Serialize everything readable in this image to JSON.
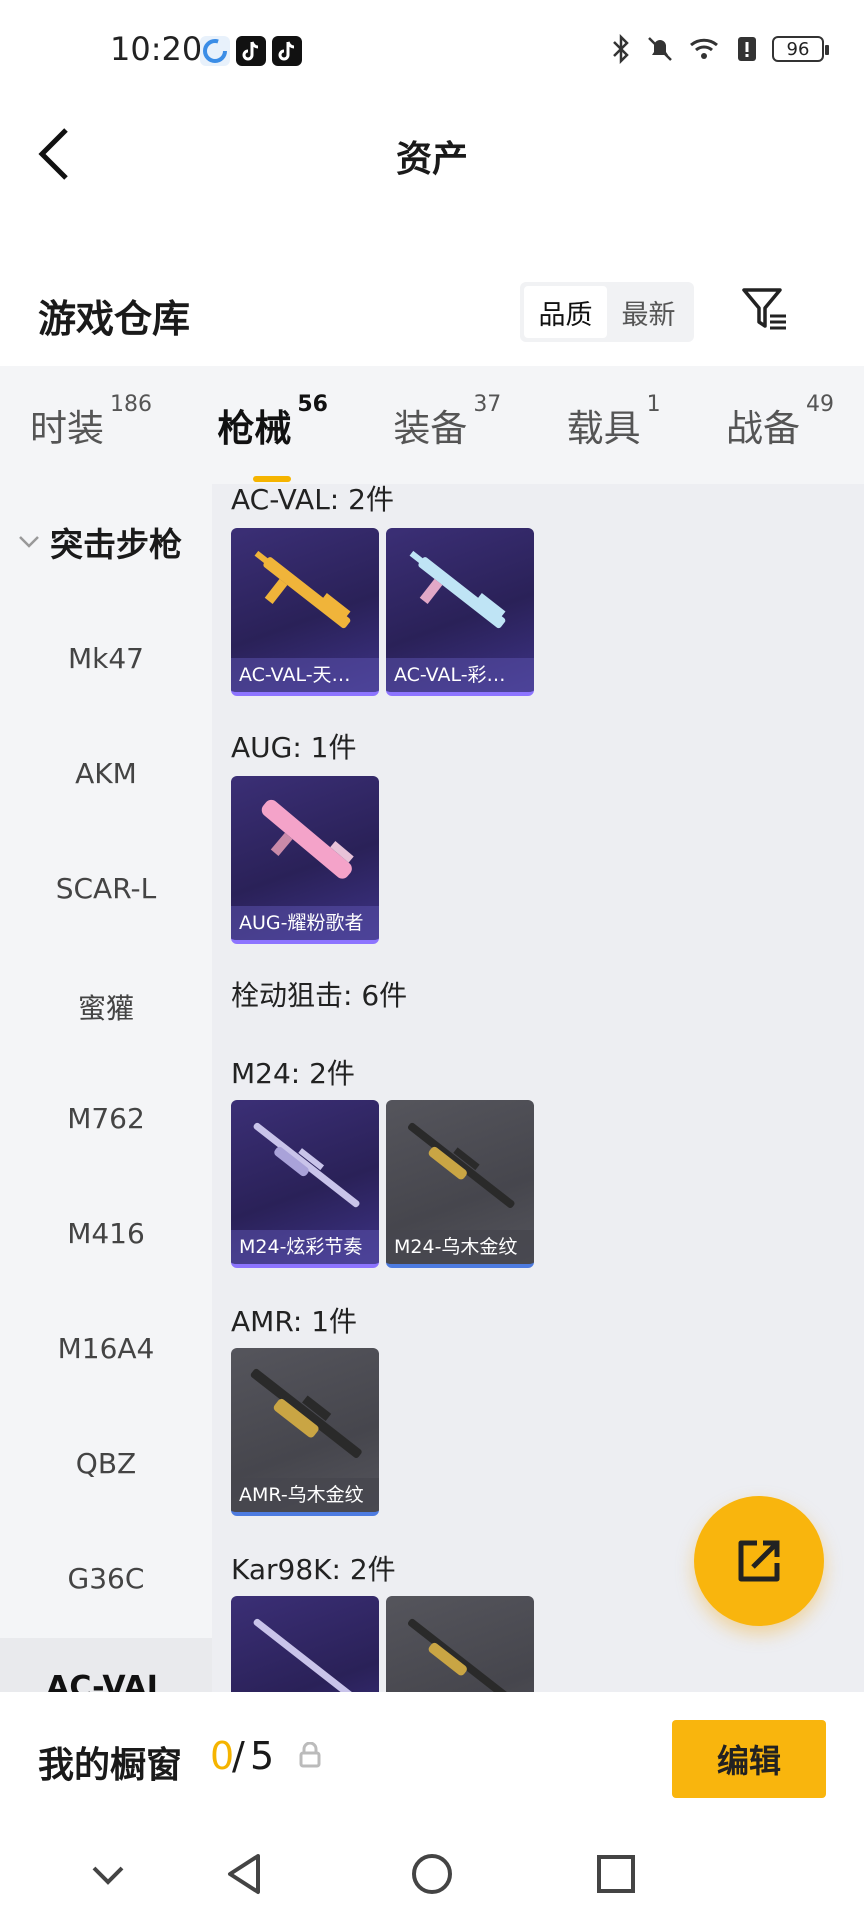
{
  "status_bar": {
    "time": "10:20",
    "battery": "96"
  },
  "header": {
    "title": "资产"
  },
  "warehouse": {
    "title": "游戏仓库",
    "sort_options": [
      "品质",
      "最新"
    ]
  },
  "tabs": [
    {
      "label": "时装",
      "count": "186"
    },
    {
      "label": "枪械",
      "count": "56"
    },
    {
      "label": "装备",
      "count": "37"
    },
    {
      "label": "载具",
      "count": "1"
    },
    {
      "label": "战备",
      "count": "49"
    }
  ],
  "sidebar": {
    "group": "突击步枪",
    "items": [
      "Mk47",
      "AKM",
      "SCAR-L",
      "蜜獾",
      "M762",
      "M416",
      "M16A4",
      "QBZ",
      "G36C",
      "AC-VAL"
    ]
  },
  "sections": [
    {
      "title": "AC-VAL: 2件",
      "items": [
        {
          "label": "AC-VAL-天…",
          "rarity": "purple",
          "hue": "#f0b43a"
        },
        {
          "label": "AC-VAL-彩…",
          "rarity": "purple",
          "hue": "#bfe4f5"
        }
      ]
    },
    {
      "title": "AUG: 1件",
      "items": [
        {
          "label": "AUG-耀粉歌者",
          "rarity": "purple",
          "hue": "#f4a3c9"
        }
      ]
    },
    {
      "title": "栓动狙击: 6件",
      "items": []
    },
    {
      "title": "M24: 2件",
      "items": [
        {
          "label": "M24-炫彩节奏",
          "rarity": "purple",
          "hue": "#c9c4ea"
        },
        {
          "label": "M24-乌木金纹",
          "rarity": "blue",
          "hue": "#c9a544"
        }
      ]
    },
    {
      "title": "AMR: 1件",
      "items": [
        {
          "label": "AMR-乌木金纹",
          "rarity": "blue",
          "hue": "#c9a544"
        }
      ]
    },
    {
      "title": "Kar98K: 2件",
      "items": [
        {
          "label": "",
          "rarity": "purple",
          "hue": "#c9c4ea"
        },
        {
          "label": "",
          "rarity": "blue",
          "hue": "#c9a544"
        }
      ]
    }
  ],
  "showcase": {
    "label": "我的橱窗",
    "current": "0",
    "separator": "/",
    "max": "5",
    "edit_label": "编辑"
  },
  "colors": {
    "accent": "#f9b50d",
    "purple_card": "#2f2566",
    "grey_card": "#4b4b52"
  }
}
